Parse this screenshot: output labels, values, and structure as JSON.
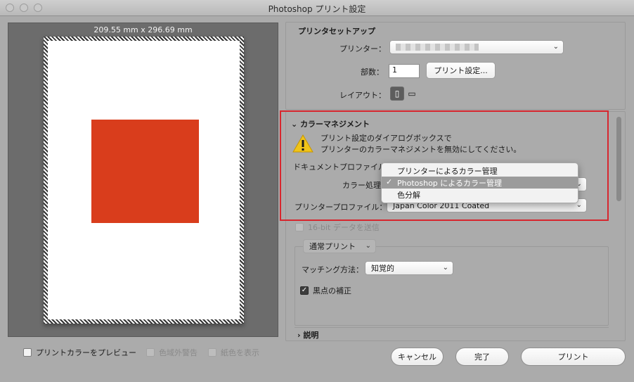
{
  "window": {
    "title": "Photoshop プリント設定"
  },
  "preview": {
    "dimensions": "209.55 mm x 296.69 mm",
    "print_color_preview_label": "プリントカラーをプレビュー",
    "gamut_warning_label": "色域外警告",
    "paper_color_label": "紙色を表示"
  },
  "printer_setup": {
    "title": "プリンタセットアップ",
    "printer_label": "プリンター：",
    "copies_label": "部数：",
    "copies_value": "1",
    "print_settings_button": "プリント設定...",
    "layout_label": "レイアウト："
  },
  "color_management": {
    "title": "カラーマネジメント",
    "warning_line1": "プリント設定のダイアログボックスで",
    "warning_line2": "プリンターのカラーマネジメントを無効にしてください。",
    "doc_profile_label": "ドキュメントプロファイル：",
    "color_handling_label": "カラー処理：",
    "printer_profile_label": "プリンタープロファイル：",
    "printer_profile_value": "Japan Color 2011 Coated",
    "send_16bit_label": "16-bit データを送信",
    "menu_items": [
      "プリンターによるカラー管理",
      "Photoshop によるカラー管理",
      "色分解"
    ],
    "selected_index": 1
  },
  "rendering": {
    "mode_select": "通常プリント",
    "matching_label": "マッチング方法：",
    "matching_value": "知覚的",
    "black_point_label": "黒点の補正"
  },
  "description": {
    "title": "説明"
  },
  "buttons": {
    "cancel": "キャンセル",
    "done": "完了",
    "print": "プリント"
  },
  "colors": {
    "preview_image": "#d93d1c",
    "highlight_frame": "#d7262e"
  }
}
